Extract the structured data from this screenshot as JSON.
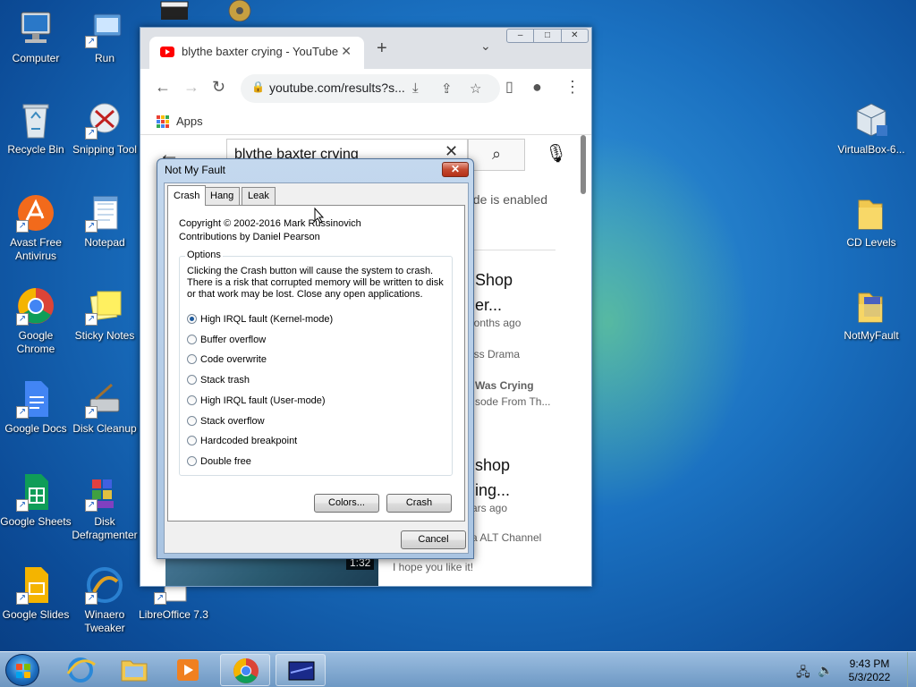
{
  "desktop": {
    "icons": [
      {
        "label": "Computer"
      },
      {
        "label": "Run"
      },
      {
        "label": "Recycle Bin"
      },
      {
        "label": "Snipping Tool"
      },
      {
        "label": "Avast Free Antivirus"
      },
      {
        "label": "Notepad"
      },
      {
        "label": "Google Chrome"
      },
      {
        "label": "Sticky Notes"
      },
      {
        "label": "Google Docs"
      },
      {
        "label": "Disk Cleanup"
      },
      {
        "label": "Google Sheets"
      },
      {
        "label": "Disk Defragmenter"
      },
      {
        "label": "Google Slides"
      },
      {
        "label": "Winaero Tweaker"
      },
      {
        "label": "LibreOffice 7.3"
      },
      {
        "label": "VirtualBox-6..."
      },
      {
        "label": "CD Levels"
      },
      {
        "label": "NotMyFault"
      }
    ]
  },
  "chrome": {
    "tab_title": "blythe baxter crying - YouTube",
    "tab_close": "✕",
    "new_tab": "+",
    "tab_menu": "⌄",
    "url": "youtube.com/results?s...",
    "bookmarks_apps": "Apps",
    "search_query": "blythe baxter crying",
    "restricted_text": "ode is enabled",
    "results": [
      {
        "line1": "Shop",
        "line2": "er...",
        "meta": "nonths ago",
        "channel": "iss Drama",
        "desc_bold": "Was Crying",
        "desc": "sode From Th..."
      },
      {
        "line1": "shop",
        "line2": "ing...",
        "meta": "ars ago",
        "channel": "a ALT Channel",
        "desc": "I hope you like it!"
      }
    ],
    "duration": "1:32",
    "window_controls": [
      "‒",
      "□",
      "✕"
    ]
  },
  "dialog": {
    "title": "Not My Fault",
    "close": "✕",
    "tabs": [
      "Crash",
      "Hang",
      "Leak"
    ],
    "copyright": "Copyright © 2002-2016 Mark Russinovich",
    "contributions": "Contributions by Daniel Pearson",
    "options_label": "Options",
    "options_desc": "Clicking the Crash button will cause the system to crash. There is a risk that corrupted memory will be written to disk or that work may be lost. Close any open applications.",
    "radios": [
      {
        "label": "High IRQL fault (Kernel-mode)",
        "checked": true
      },
      {
        "label": "Buffer overflow",
        "checked": false
      },
      {
        "label": "Code overwrite",
        "checked": false
      },
      {
        "label": "Stack trash",
        "checked": false
      },
      {
        "label": "High IRQL fault (User-mode)",
        "checked": false
      },
      {
        "label": "Stack overflow",
        "checked": false
      },
      {
        "label": "Hardcoded breakpoint",
        "checked": false
      },
      {
        "label": "Double free",
        "checked": false
      }
    ],
    "colors_button": "Colors...",
    "crash_button": "Crash",
    "cancel_button": "Cancel"
  },
  "taskbar": {
    "time": "9:43 PM",
    "date": "5/3/2022"
  },
  "colors": {
    "youtube_red": "#ff0000",
    "win_accent": "#1e5a9c"
  }
}
